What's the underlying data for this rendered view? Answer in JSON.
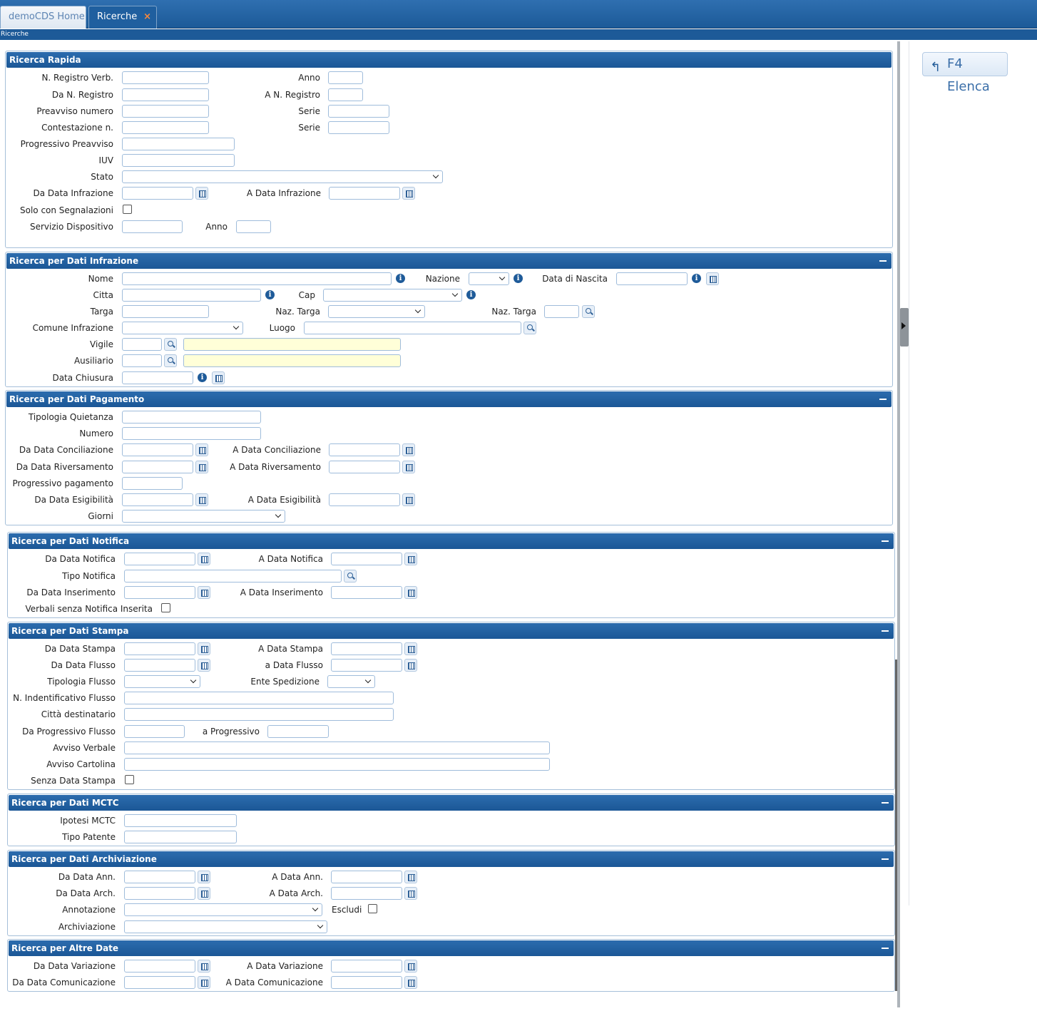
{
  "tabs": {
    "home": "demoCDS Home",
    "ricerche": "Ricerche",
    "close": "×"
  },
  "breadcrumb": "Ricerche",
  "elenca_button": "F4 Elenca",
  "rapida": {
    "title": "Ricerca Rapida",
    "n_registro": "N. Registro Verb.",
    "anno": "Anno",
    "da_n_registro": "Da N. Registro",
    "a_n_registro": "A N. Registro",
    "preavviso": "Preavviso numero",
    "serie": "Serie",
    "contestazione": "Contestazione n.",
    "serie2": "Serie",
    "progressivo": "Progressivo Preavviso",
    "iuv": "IUV",
    "stato": "Stato",
    "da_data": "Da Data Infrazione",
    "a_data": "A Data Infrazione",
    "solo_segn": "Solo con Segnalazioni",
    "servizio": "Servizio Dispositivo",
    "anno2": "Anno"
  },
  "infrazione": {
    "title": "Ricerca per Dati Infrazione",
    "nome": "Nome",
    "nazione": "Nazione",
    "data_nascita": "Data di Nascita",
    "citta": "Citta",
    "cap": "Cap",
    "targa": "Targa",
    "naz_targa": "Naz. Targa",
    "naz_targa2": "Naz. Targa",
    "comune": "Comune Infrazione",
    "luogo": "Luogo",
    "vigile": "Vigile",
    "ausiliario": "Ausiliario",
    "data_chiusura": "Data Chiusura"
  },
  "pagamento": {
    "title": "Ricerca per Dati Pagamento",
    "tipologia": "Tipologia Quietanza",
    "numero": "Numero",
    "da_conc": "Da Data Conciliazione",
    "a_conc": "A Data Conciliazione",
    "da_riv": "Da Data Riversamento",
    "a_riv": "A Data Riversamento",
    "progressivo": "Progressivo pagamento",
    "da_esig": "Da Data Esigibilità",
    "a_esig": "A Data Esigibilità",
    "giorni": "Giorni"
  },
  "notifica": {
    "title": "Ricerca per Dati Notifica",
    "da_notifica": "Da Data Notifica",
    "a_notifica": "A Data Notifica",
    "tipo": "Tipo Notifica",
    "da_ins": "Da Data Inserimento",
    "a_ins": "A Data Inserimento",
    "verbali_senza": "Verbali senza Notifica Inserita"
  },
  "stampa": {
    "title": "Ricerca per Dati Stampa",
    "da_stampa": "Da Data Stampa",
    "a_stampa": "A Data Stampa",
    "da_flusso": "Da Data Flusso",
    "a_flusso": "a Data Flusso",
    "tipologia": "Tipologia Flusso",
    "ente": "Ente Spedizione",
    "n_ident": "N. Indentificativo Flusso",
    "citta_dest": "Città destinatario",
    "da_prog": "Da Progressivo Flusso",
    "a_prog": "a Progressivo",
    "avviso_verb": "Avviso Verbale",
    "avviso_cart": "Avviso Cartolina",
    "senza": "Senza Data Stampa"
  },
  "mctc": {
    "title": "Ricerca per Dati MCTC",
    "ipotesi": "Ipotesi MCTC",
    "tipo_patente": "Tipo Patente"
  },
  "archiviazione": {
    "title": "Ricerca per Dati Archiviazione",
    "da_ann": "Da Data Ann.",
    "a_ann": "A Data Ann.",
    "da_arch": "Da Data Arch.",
    "a_arch": "A Data Arch.",
    "annotazione": "Annotazione",
    "escludi": "Escludi",
    "archiviazione": "Archiviazione"
  },
  "altre": {
    "title": "Ricerca per Altre Date",
    "da_var": "Da Data Variazione",
    "a_var": "A Data Variazione",
    "da_com": "Da Data Comunicazione",
    "a_com": "A Data Comunicazione"
  }
}
